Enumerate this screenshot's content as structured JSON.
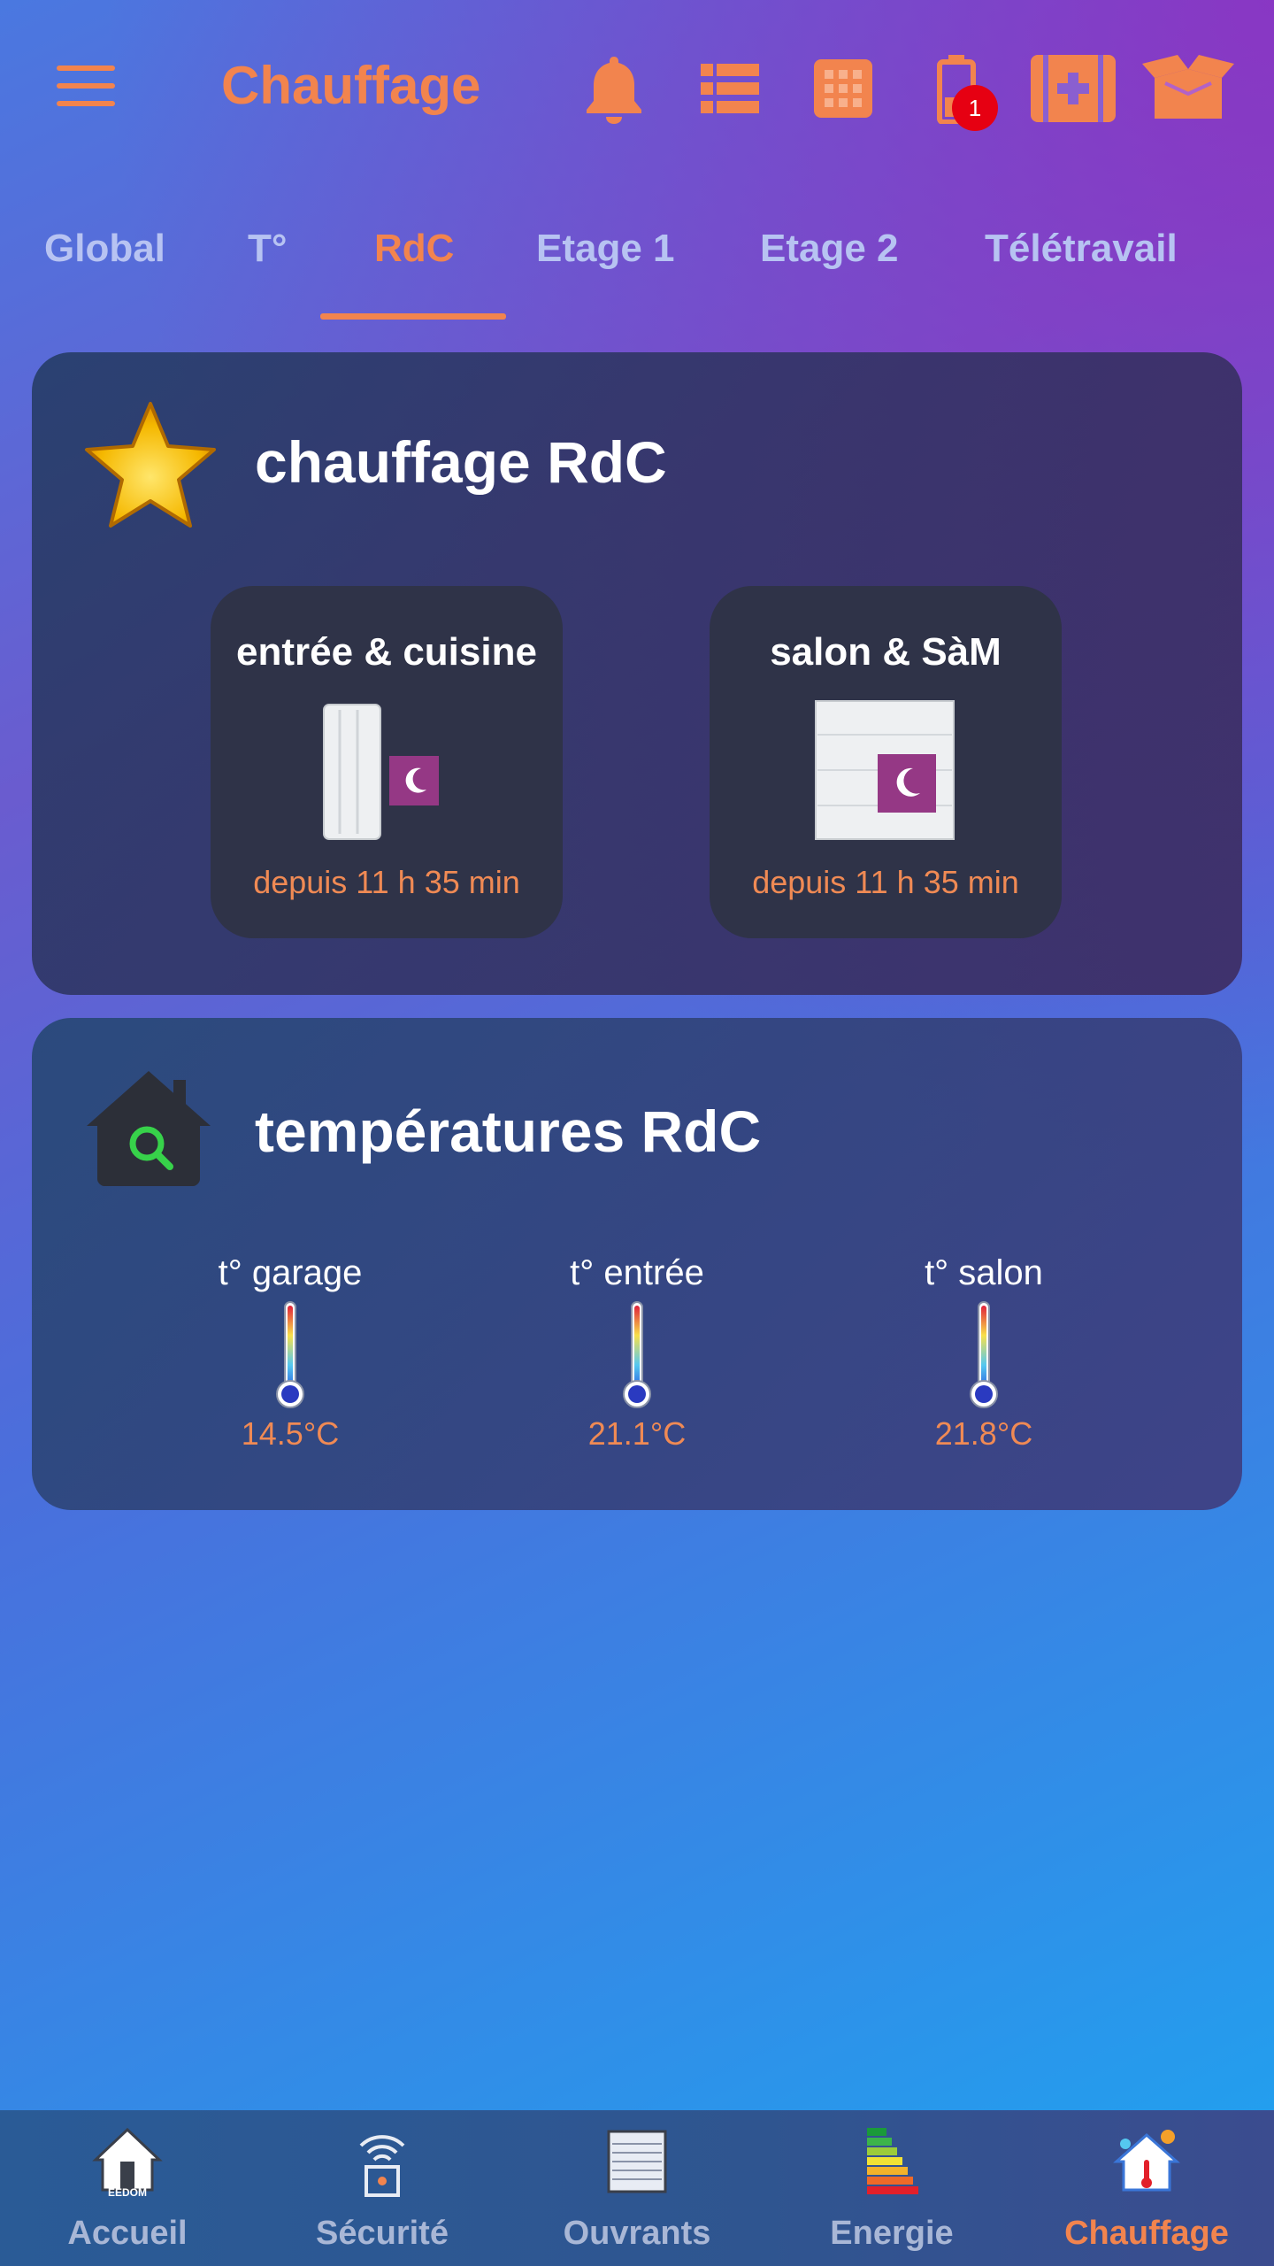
{
  "header": {
    "title": "Chauffage",
    "notification_count": "1",
    "icons": [
      "menu-icon",
      "bell-icon",
      "list-icon",
      "grid-icon",
      "battery-icon",
      "health-icon",
      "box-icon"
    ],
    "accent_color": "#f2844e"
  },
  "tabs": [
    {
      "label": "Global"
    },
    {
      "label": "T°"
    },
    {
      "label": "RdC",
      "active": true
    },
    {
      "label": "Etage 1"
    },
    {
      "label": "Etage 2"
    },
    {
      "label": "Télétravail"
    }
  ],
  "heating_card": {
    "title": "chauffage RdC",
    "icon": "star-icon",
    "tiles": [
      {
        "label": "entrée & cuisine",
        "status": "depuis 11 h 35 min",
        "icon": "radiator-eco-icon"
      },
      {
        "label": "salon & SàM",
        "status": "depuis 11 h 35 min",
        "icon": "radiator-eco-icon"
      }
    ]
  },
  "temperature_card": {
    "title": "températures RdC",
    "icon": "house-search-icon",
    "sensors": [
      {
        "label": "t° garage",
        "value": "14.5°C"
      },
      {
        "label": "t° entrée",
        "value": "21.1°C"
      },
      {
        "label": "t° salon",
        "value": "21.8°C"
      }
    ]
  },
  "bottom_nav": [
    {
      "label": "Accueil",
      "icon": "jeedom-home-icon"
    },
    {
      "label": "Sécurité",
      "icon": "alarm-icon"
    },
    {
      "label": "Ouvrants",
      "icon": "shutter-icon"
    },
    {
      "label": "Energie",
      "icon": "energy-label-icon"
    },
    {
      "label": "Chauffage",
      "icon": "heating-house-icon",
      "active": true
    }
  ]
}
